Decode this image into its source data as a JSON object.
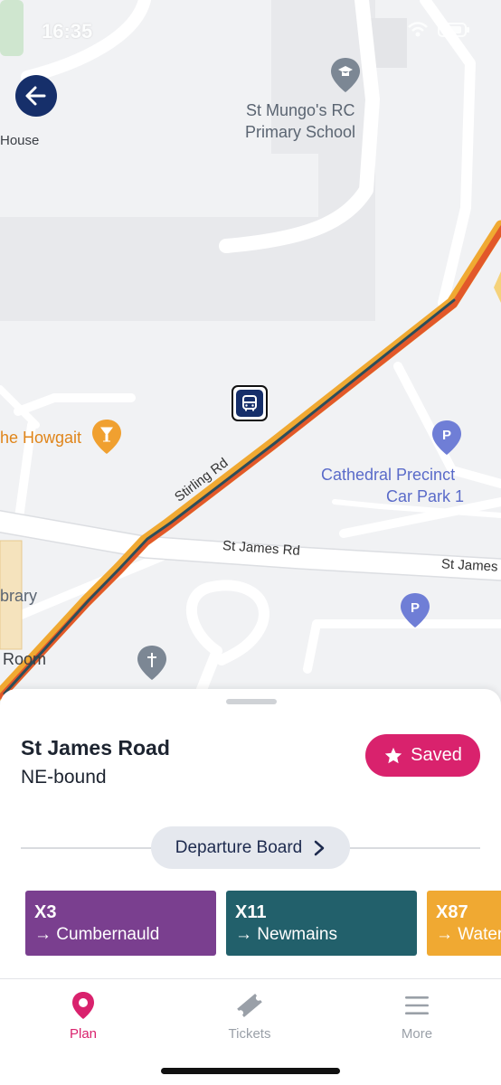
{
  "status": {
    "time": "16:35"
  },
  "map": {
    "labels": {
      "house": "House",
      "school_line1": "St Mungo's RC",
      "school_line2": "Primary School",
      "howgait": "he Howgait",
      "car_park_line1": "Cathedral Precinct",
      "car_park_line2": "Car Park 1",
      "library": "brary",
      "room": "Room"
    },
    "roads": {
      "stirling": "Stirling Rd",
      "st_james": "St James Rd",
      "st_james_short": "St James"
    }
  },
  "stop": {
    "name": "St James Road",
    "direction": "NE-bound",
    "saved_label": "Saved",
    "departure_board_label": "Departure Board"
  },
  "routes": [
    {
      "number": "X3",
      "destination": "→ Cumbernauld",
      "color": "#7a3f8f"
    },
    {
      "number": "X11",
      "destination": "→ Newmains",
      "color": "#22606b"
    },
    {
      "number": "X87",
      "destination": "→ Water",
      "color": "#f0a932"
    }
  ],
  "tabs": [
    {
      "label": "Plan",
      "icon": "map-pin-icon",
      "active": true
    },
    {
      "label": "Tickets",
      "icon": "ticket-icon",
      "active": false
    },
    {
      "label": "More",
      "icon": "menu-icon",
      "active": false
    }
  ],
  "colors": {
    "accent": "#d9226d",
    "navy": "#162f6a"
  }
}
